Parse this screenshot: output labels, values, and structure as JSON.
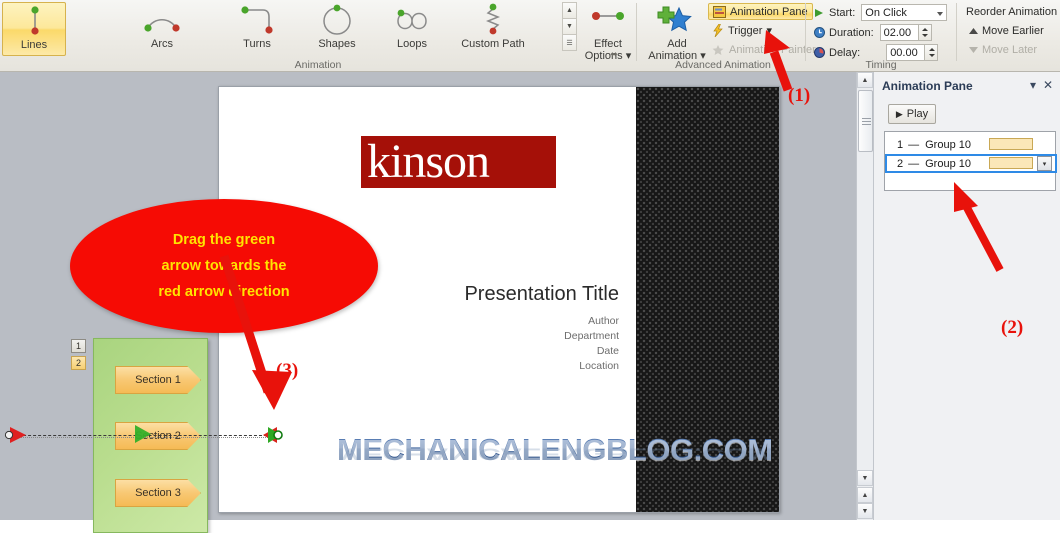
{
  "ribbon": {
    "gallery": {
      "items": [
        {
          "label": "Lines",
          "icon": "motion-path-lines-icon",
          "selected": true
        },
        {
          "label": "Arcs",
          "icon": "motion-path-arcs-icon",
          "selected": false
        },
        {
          "label": "Turns",
          "icon": "motion-path-turns-icon",
          "selected": false
        },
        {
          "label": "Shapes",
          "icon": "motion-path-shapes-icon",
          "selected": false
        },
        {
          "label": "Loops",
          "icon": "motion-path-loops-icon",
          "selected": false
        },
        {
          "label": "Custom Path",
          "icon": "motion-path-custom-icon",
          "selected": false
        }
      ],
      "group_label": "Animation",
      "scroll_up": "▲",
      "scroll_down": "▼",
      "more": "☰"
    },
    "effect_options": {
      "line1": "Effect",
      "line2": "Options",
      "caret": "▾",
      "dialog_launcher": "⬌"
    },
    "advanced": {
      "group_label": "Advanced Animation",
      "add_animation_line1": "Add",
      "add_animation_line2": "Animation",
      "add_animation_caret": "▾",
      "animation_pane_label": "Animation Pane",
      "trigger_label": "Trigger",
      "trigger_caret": "▾",
      "animation_painter_label": "Animation Painter"
    },
    "timing": {
      "group_label": "Timing",
      "start_label": "Start:",
      "start_value": "On Click",
      "duration_label": "Duration:",
      "duration_value": "02.00",
      "delay_label": "Delay:",
      "delay_value": "00.00",
      "reorder_label": "Reorder Animation",
      "move_earlier": "Move Earlier",
      "move_later": "Move Later"
    }
  },
  "callout": {
    "line1": "Drag the green",
    "line2": "arrow towards the",
    "line3": "red arrow direction",
    "fill_color": "#f60b04",
    "text_color": "#ffe400"
  },
  "markers": {
    "one": "(1)",
    "two": "(2)",
    "three": "(3)"
  },
  "slide": {
    "logo_text": "kinson",
    "logo_color": "#a51008",
    "title": "Presentation Title",
    "subtitle_lines": [
      "Author",
      "Department",
      "Date",
      "Location"
    ],
    "watermark": "MECHANICALENGBLOG.COM",
    "sections": [
      "Section 1",
      "Section 2",
      "Section 3"
    ],
    "sequence_tags": [
      "1",
      "2"
    ]
  },
  "animation_pane": {
    "title": "Animation Pane",
    "menu_icon": "▾",
    "close_icon": "✕",
    "play_label": "Play",
    "play_icon": "▶",
    "rows": [
      {
        "index": "1",
        "dash": "—",
        "name": "Group 10",
        "selected": false
      },
      {
        "index": "2",
        "dash": "—",
        "name": "Group 10",
        "selected": true
      }
    ],
    "row_dropdown_icon": "▾"
  },
  "scrollbar": {
    "up": "▲",
    "down": "▼",
    "prev": "▲",
    "next": "▼"
  }
}
